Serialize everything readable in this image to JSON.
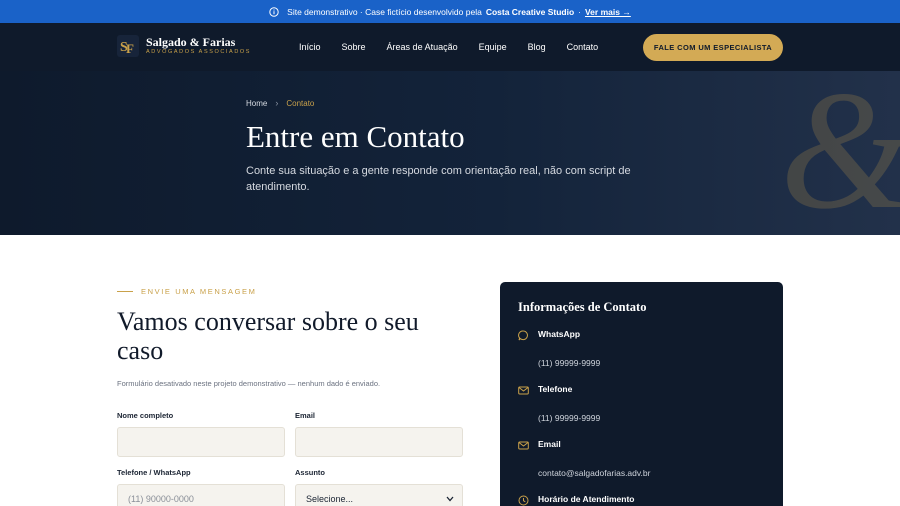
{
  "banner": {
    "text": "Site demonstrativo · Case fictício desenvolvido pela",
    "studio": "Costa Creative Studio",
    "dot": "·",
    "link": "Ver mais →"
  },
  "header": {
    "logo_name": "Salgado & Farias",
    "logo_sub": "ADVOGADOS ASSOCIADOS",
    "nav": [
      "Início",
      "Sobre",
      "Áreas de Atuação",
      "Equipe",
      "Blog",
      "Contato"
    ],
    "cta": "FALE COM UM ESPECIALISTA"
  },
  "hero": {
    "breadcrumb_home": "Home",
    "breadcrumb_sep": "›",
    "breadcrumb_current": "Contato",
    "title": "Entre em Contato",
    "subtitle": "Conte sua situação e a gente responde com orientação real, não com script de atendimento.",
    "decor": "&"
  },
  "form": {
    "eyebrow": "ENVIE UMA MENSAGEM",
    "title": "Vamos conversar sobre o seu caso",
    "note": "Formulário desativado neste projeto demonstrativo — nenhum dado é enviado.",
    "name_label": "Nome completo",
    "name_value": "",
    "email_label": "Email",
    "email_value": "",
    "phone_label": "Telefone / WhatsApp",
    "phone_placeholder": "(11) 90000-0000",
    "subject_label": "Assunto",
    "subject_selected": "Selecione..."
  },
  "info": {
    "title": "Informações de Contato",
    "items": [
      {
        "title": "WhatsApp",
        "value": "(11) 99999-9999",
        "icon": "chat-icon"
      },
      {
        "title": "Telefone",
        "value": "(11) 99999-9999",
        "icon": "mail-icon"
      },
      {
        "title": "Email",
        "value": "contato@salgadofarias.adv.br",
        "icon": "mail-icon"
      },
      {
        "title": "Horário de Atendimento",
        "value": "",
        "icon": "clock-icon"
      }
    ]
  },
  "colors": {
    "banner": "#1a62c8",
    "navy": "#0f1a2b",
    "gold": "#c9a14a",
    "cta": "#d3aa55"
  }
}
